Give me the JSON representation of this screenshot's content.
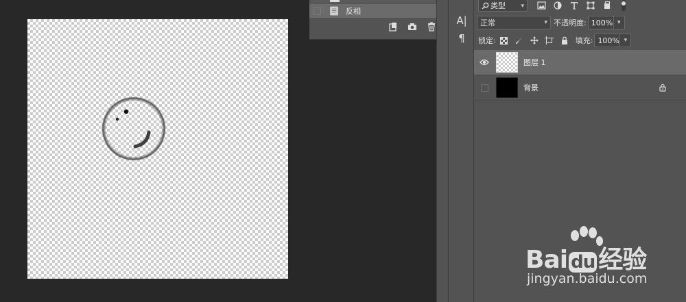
{
  "history": {
    "step_label": "反相"
  },
  "tools": {
    "character_glyph": "A|",
    "paragraph_glyph": "¶"
  },
  "layers": {
    "filter_label": "类型",
    "blend_mode": "正常",
    "opacity_label": "不透明度:",
    "opacity_value": "100%",
    "lock_label": "锁定:",
    "fill_label": "填充:",
    "fill_value": "100%",
    "items": [
      {
        "name": "图层 1",
        "visible": true,
        "selected": true,
        "thumbnail": "transparent"
      },
      {
        "name": "背景",
        "visible": false,
        "selected": false,
        "thumbnail": "black",
        "locked": true
      }
    ]
  },
  "icons": {
    "filter_kinds": [
      "image-filter-icon",
      "adjustment-filter-icon",
      "type-filter-icon",
      "shape-filter-icon",
      "smart-object-filter-icon"
    ],
    "lock_kinds": [
      "lock-transparent-icon",
      "lock-image-icon",
      "lock-position-icon",
      "lock-artboard-icon",
      "lock-all-icon"
    ]
  },
  "watermark": {
    "brand_lead": "Bai",
    "brand_mid": "du",
    "brand_tail": "经验",
    "url": "jingyan.baidu.com"
  },
  "colors": {
    "panel": "#535353",
    "workspace": "#282828",
    "selected_row": "#6a6a6a"
  }
}
